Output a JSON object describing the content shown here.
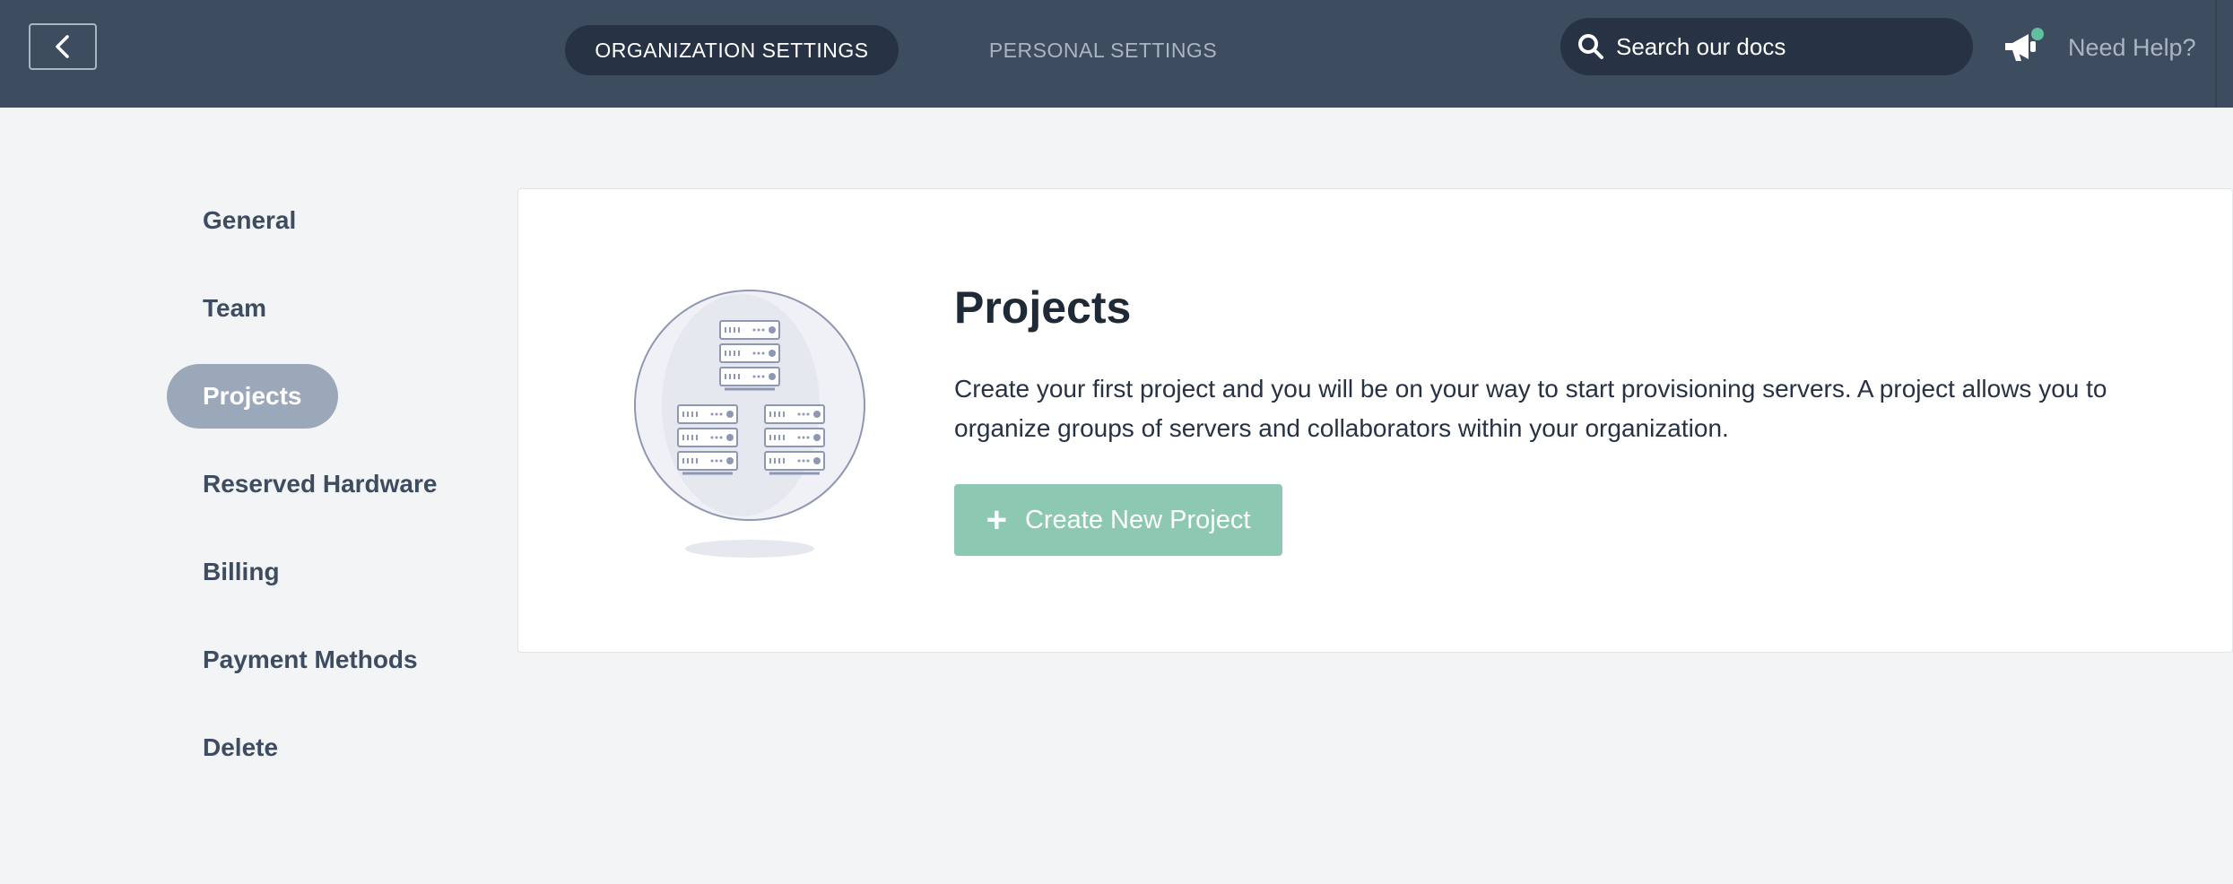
{
  "header": {
    "tabs": [
      {
        "label": "ORGANIZATION SETTINGS",
        "active": true
      },
      {
        "label": "PERSONAL SETTINGS",
        "active": false
      }
    ],
    "search": {
      "placeholder": "Search our docs"
    },
    "help_label": "Need Help?",
    "notification_dot_color": "#5fbf9f"
  },
  "sidebar": {
    "items": [
      {
        "label": "General"
      },
      {
        "label": "Team"
      },
      {
        "label": "Projects",
        "active": true
      },
      {
        "label": "Reserved Hardware"
      },
      {
        "label": "Billing"
      },
      {
        "label": "Payment Methods"
      },
      {
        "label": "Delete"
      }
    ]
  },
  "main": {
    "title": "Projects",
    "description": "Create your first project and you will be on your way to start provisioning servers. A project allows you to organize groups of servers and collaborators within your organization.",
    "create_button_label": "Create New Project"
  },
  "colors": {
    "header_bg": "#3e4c60",
    "active_pill": "#273244",
    "accent": "#8dc9b2",
    "nav_active": "#9aa8ba"
  },
  "icons": {
    "back": "chevron-left-icon",
    "search": "search-icon",
    "announcement": "megaphone-icon",
    "create": "plus-icon",
    "illustration": "server-racks-illustration"
  }
}
